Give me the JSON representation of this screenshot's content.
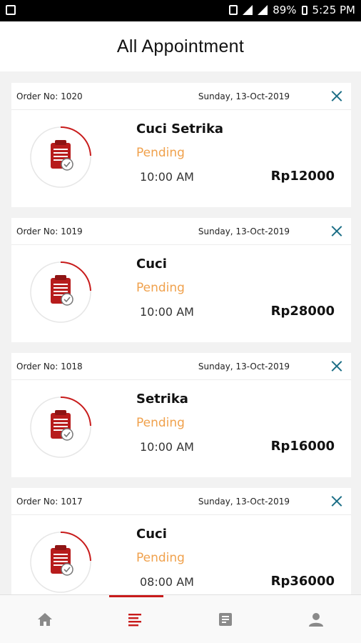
{
  "status_bar": {
    "battery": "89%",
    "time": "5:25 PM"
  },
  "header": {
    "title": "All Appointment"
  },
  "appointments": [
    {
      "order_no": "Order No: 1020",
      "date": "Sunday, 13-Oct-2019",
      "service": "Cuci Setrika",
      "status": "Pending",
      "time": "10:00 AM",
      "price": "Rp12000"
    },
    {
      "order_no": "Order No: 1019",
      "date": "Sunday, 13-Oct-2019",
      "service": "Cuci",
      "status": "Pending",
      "time": "10:00 AM",
      "price": "Rp28000"
    },
    {
      "order_no": "Order No: 1018",
      "date": "Sunday, 13-Oct-2019",
      "service": "Setrika",
      "status": "Pending",
      "time": "10:00 AM",
      "price": "Rp16000"
    },
    {
      "order_no": "Order No: 1017",
      "date": "Sunday, 13-Oct-2019",
      "service": "Cuci",
      "status": "Pending",
      "time": "08:00 AM",
      "price": "Rp36000"
    }
  ],
  "bottom_nav": {
    "items": [
      {
        "icon": "home-icon",
        "active": false
      },
      {
        "icon": "list-icon",
        "active": true
      },
      {
        "icon": "document-icon",
        "active": false
      },
      {
        "icon": "profile-icon",
        "active": false
      }
    ]
  },
  "colors": {
    "accent_red": "#c81b1b",
    "pending": "#f0a14c",
    "close_icon": "#1b6e86"
  }
}
